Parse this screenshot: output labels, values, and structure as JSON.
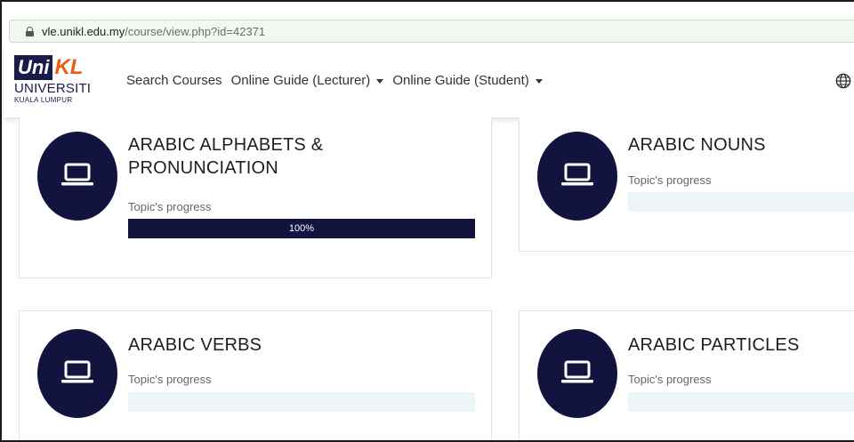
{
  "browser": {
    "url_host": "vle.unikl.edu.my",
    "url_path": "/course/view.php?id=42371"
  },
  "logo": {
    "uni": "Uni",
    "kl": "KL",
    "line1": "UNIVERSITI",
    "line2": "KUALA LUMPUR"
  },
  "nav": {
    "items": [
      {
        "label": "Search Courses"
      },
      {
        "label": "Online Guide (Lecturer)"
      },
      {
        "label": "Online Guide (Student)"
      }
    ]
  },
  "topics": [
    {
      "title": "ARABIC ALPHABETS & PRONUNCIATION",
      "progress_label": "Topic's progress",
      "progress": 100,
      "progress_text": "100%"
    },
    {
      "title": "ARABIC NOUNS",
      "progress_label": "Topic's progress",
      "progress": 0
    },
    {
      "title": "ARABIC VERBS",
      "progress_label": "Topic's progress",
      "progress": 0
    },
    {
      "title": "ARABIC PARTICLES",
      "progress_label": "Topic's progress",
      "progress": 0
    }
  ],
  "colors": {
    "brand_navy": "#13133f",
    "brand_orange": "#e85d12",
    "bar_track": "#eef5f8"
  },
  "icons": {
    "topic": "laptop-icon",
    "language": "globe-icon",
    "secure": "lock-icon"
  }
}
